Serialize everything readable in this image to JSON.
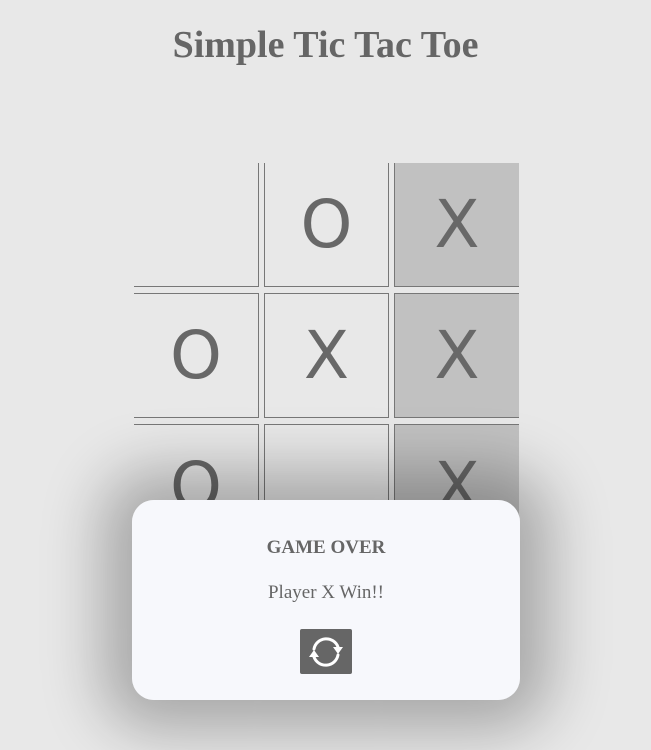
{
  "title": "Simple Tic Tac Toe",
  "board": {
    "cells": [
      "",
      "O",
      "X",
      "O",
      "X",
      "X",
      "O",
      "",
      "X"
    ],
    "winning_cells": [
      2,
      5,
      8
    ]
  },
  "modal": {
    "title": "GAME OVER",
    "message": "Player X Win!!",
    "restart_icon": "refresh-icon"
  },
  "colors": {
    "background": "#e8e8e8",
    "text": "#666666",
    "winning_cell": "#c1c1c1",
    "modal_background": "#f7f8fc",
    "button": "#666666"
  }
}
